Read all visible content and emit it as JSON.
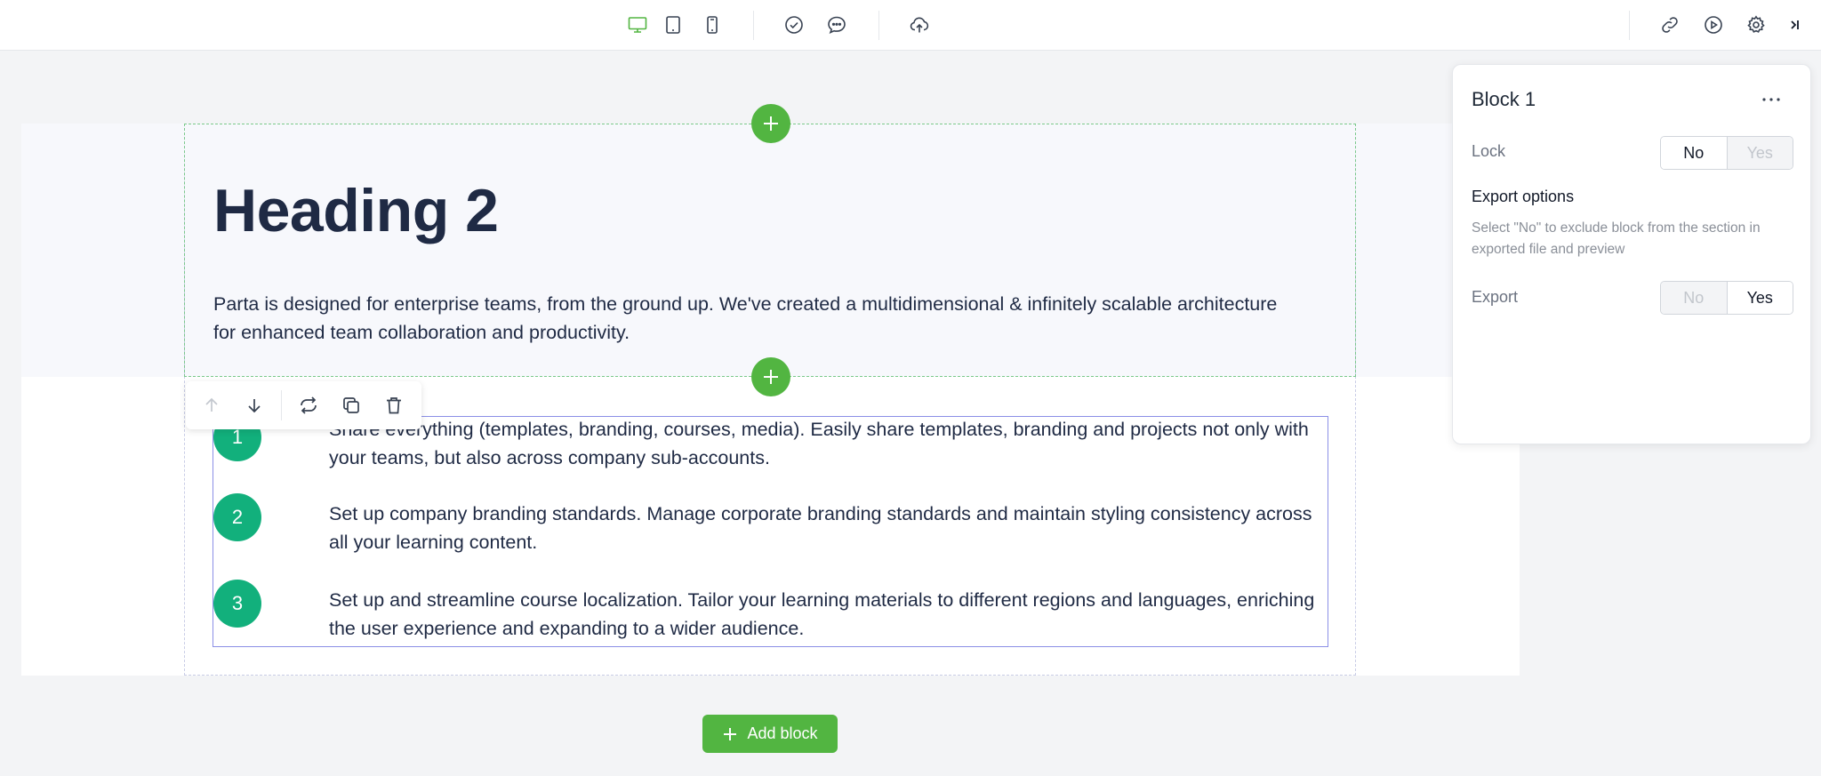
{
  "content": {
    "heading": "Heading 2",
    "hero_text": "Parta is designed for enterprise teams, from the ground up. We've created a multidimensional & infinitely scalable architecture for enhanced team collaboration and productivity.",
    "list_items": [
      {
        "number": "1",
        "text": "Share everything (templates, branding, courses, media). Easily share templates, branding and projects not only with your teams, but also across company sub-accounts."
      },
      {
        "number": "2",
        "text": "Set up company branding standards. Manage corporate branding standards and maintain styling consistency across all your learning content."
      },
      {
        "number": "3",
        "text": "Set up and streamline course localization. Tailor your learning materials to different regions and languages, enriching the user experience and expanding to a wider audience."
      }
    ]
  },
  "add_block_label": "Add block",
  "panel": {
    "title": "Block 1",
    "lock_label": "Lock",
    "lock_options": [
      "No",
      "Yes"
    ],
    "lock_selected": "No",
    "export_options_heading": "Export options",
    "export_description": "Select \"No\" to exclude block from the section in exported file and preview",
    "export_label": "Export",
    "export_options": [
      "No",
      "Yes"
    ],
    "export_selected": "Yes"
  },
  "colors": {
    "accent_green": "#52b541",
    "number_green": "#12b07c",
    "selection_outline": "#8b8fe6",
    "text_dark": "#1f2a44"
  },
  "icons": {
    "toolbar_left": [
      "desktop-icon",
      "tablet-icon",
      "mobile-icon"
    ],
    "toolbar_mid": [
      "check-circle-icon",
      "comment-icon"
    ],
    "toolbar_publish": "cloud-upload-icon",
    "toolbar_right": [
      "link-icon",
      "play-icon",
      "gear-icon",
      "collapse-panel-icon"
    ],
    "block_toolbar": [
      "arrow-up-icon",
      "arrow-down-icon",
      "swap-icon",
      "duplicate-icon",
      "trash-icon"
    ]
  }
}
